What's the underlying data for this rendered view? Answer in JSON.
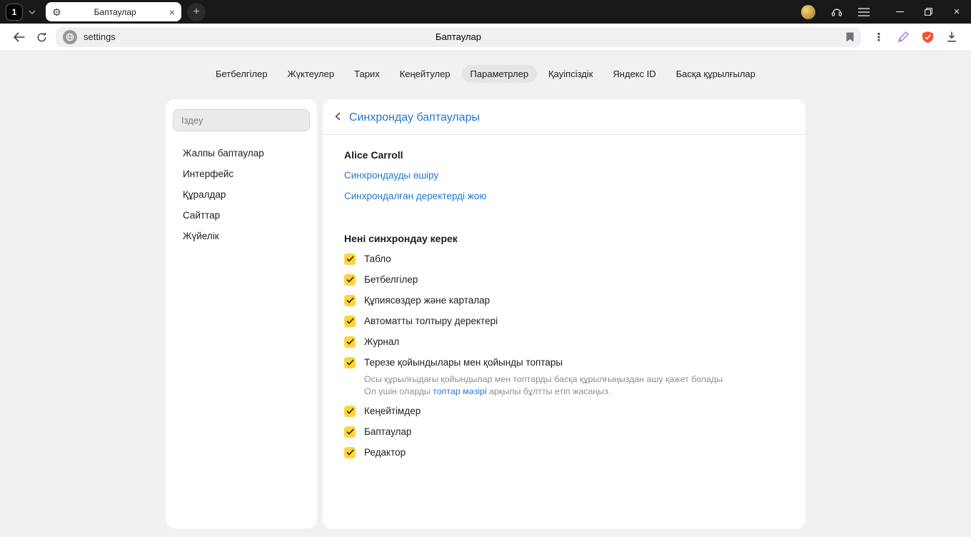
{
  "icons": {
    "gear": "⚙",
    "plus": "+",
    "close": "×",
    "kebab": "⋮"
  },
  "colors": {
    "titlebar": "#18181b",
    "checkbox_yellow": "#ffd33d",
    "link_blue": "#2478d1",
    "protect_red": "#fb4e30",
    "pen_purple": "#bb76e4",
    "selected_tab_pill": "#e7e5e2"
  },
  "titlebar": {
    "tab_count": "1",
    "tab_title": "Баптаулар"
  },
  "toolbar": {
    "url_text": "settings",
    "page_title": "Баптаулар"
  },
  "page_tabs": {
    "items": [
      {
        "label": "Бетбелгілер",
        "selected": false
      },
      {
        "label": "Жүктеулер",
        "selected": false
      },
      {
        "label": "Тарих",
        "selected": false
      },
      {
        "label": "Кеңейтулер",
        "selected": false
      },
      {
        "label": "Параметрлер",
        "selected": true
      },
      {
        "label": "Қауіпсіздік",
        "selected": false
      },
      {
        "label": "Яндекс ID",
        "selected": false
      },
      {
        "label": "Басқа құрылғылар",
        "selected": false
      }
    ]
  },
  "sidebar": {
    "search_placeholder": "Іздеу",
    "items": [
      {
        "label": "Жалпы баптаулар"
      },
      {
        "label": "Интерфейс"
      },
      {
        "label": "Құралдар"
      },
      {
        "label": "Сайттар"
      },
      {
        "label": "Жүйелік"
      }
    ]
  },
  "main": {
    "title": "Синхрондау баптаулары",
    "account_name": "Alice Carroll",
    "link_disable_sync": "Синхрондауды өшіру",
    "link_delete_data": "Синхрондалған деректерді жою",
    "section_title": "Нені синхрондау керек",
    "sync_items": [
      {
        "label": "Табло",
        "checked": true
      },
      {
        "label": "Бетбелгілер",
        "checked": true
      },
      {
        "label": "Құпиясөздер және карталар",
        "checked": true
      },
      {
        "label": "Автоматты толтыру деректері",
        "checked": true
      },
      {
        "label": "Журнал",
        "checked": true
      },
      {
        "label": "Терезе қойындылары мен қойынды топтары",
        "checked": true
      },
      {
        "label": "Кеңейтімдер",
        "checked": true
      },
      {
        "label": "Баптаулар",
        "checked": true
      },
      {
        "label": "Редактор",
        "checked": true
      }
    ],
    "tabs_note": {
      "line1": "Осы құрылғыдағы қойындылар мен топтарды басқа құрылғыңыздан ашу қажет болады",
      "line2_prefix": "Ол үшін оларды ",
      "link": "топтар мәзірі",
      "line2_suffix": " арқылы бұлтты етіп жасаңыз."
    }
  }
}
